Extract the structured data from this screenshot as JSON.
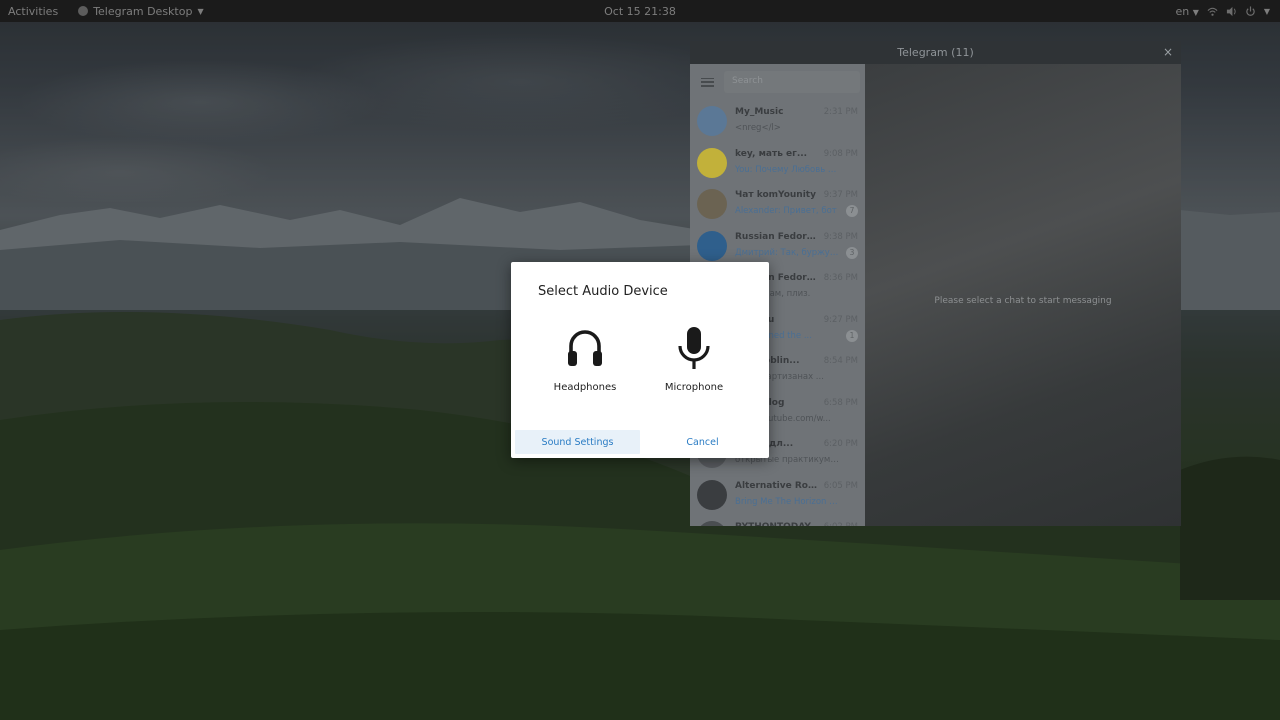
{
  "topbar": {
    "activities": "Activities",
    "app_menu": "Telegram Desktop",
    "clock": "Oct 15  21:38",
    "lang": "en"
  },
  "telegram": {
    "window_title": "Telegram (11)",
    "search_placeholder": "Search",
    "empty_state": "Please select a chat to start messaging",
    "chats": [
      {
        "name": "My_Music",
        "time": "2:31 PM",
        "preview": "<nreg</l>",
        "preview_blue": false,
        "avatar_color": "#5b7896",
        "badge": ""
      },
      {
        "name": "key, мать ег...",
        "time": "9:08 PM",
        "preview": "You: Почему Любовь Т...",
        "preview_blue": true,
        "avatar_color": "#c2b13a",
        "badge": ""
      },
      {
        "name": "Чат komYounity",
        "time": "9:37 PM",
        "preview": "Alexander: Привет, бот",
        "preview_blue": true,
        "avatar_color": "#6b6352",
        "badge": "7"
      },
      {
        "name": "Russian Fedora...",
        "time": "9:38 PM",
        "preview": "Дмитрий: Так, буржуи г...",
        "preview_blue": true,
        "avatar_color": "#2f5f8c",
        "badge": "3"
      },
      {
        "name": "Russian Fedora...",
        "time": "8:36 PM",
        "preview": "Удали сам, плиз.",
        "preview_blue": false,
        "avatar_color": "#4a6f94",
        "badge": ""
      },
      {
        "name": "OME Ru",
        "time": "9:27 PM",
        "preview": "rown joined the ...",
        "preview_blue": true,
        "avatar_color": "#4b4f52",
        "badge": "1"
      },
      {
        "name": "40k Goblin...",
        "time": "8:54 PM",
        "preview": "ков о партизанах ...",
        "preview_blue": false,
        "avatar_color": "#555a5d",
        "badge": ""
      },
      {
        "name": "tream.log",
        "time": "6:58 PM",
        "preview": "www.youtube.com/w...",
        "preview_blue": false,
        "avatar_color": "#5a5f62",
        "badge": ""
      },
      {
        "name": "Книги дл...",
        "time": "6:20 PM",
        "preview": "открытые практикумы Dev...",
        "preview_blue": false,
        "avatar_color": "#585c5f",
        "badge": ""
      },
      {
        "name": "Alternative Roc...",
        "time": "6:05 PM",
        "preview": "Bring Me The Horizon – Brin...",
        "preview_blue": true,
        "avatar_color": "#3a3d40",
        "badge": ""
      },
      {
        "name": "PYTHONTODAY",
        "time": "6:02 PM",
        "preview": "",
        "preview_blue": false,
        "avatar_color": "#4a4e51",
        "badge": ""
      }
    ]
  },
  "dialog": {
    "title": "Select Audio Device",
    "devices": [
      {
        "label": "Headphones",
        "icon": "headphones-icon"
      },
      {
        "label": "Microphone",
        "icon": "microphone-icon"
      }
    ],
    "buttons": {
      "sound_settings": "Sound Settings",
      "cancel": "Cancel"
    }
  },
  "colors": {
    "accent": "#2a7cc4",
    "dialog_bg": "#ffffff",
    "topbar_bg": "#1b1b1b"
  }
}
